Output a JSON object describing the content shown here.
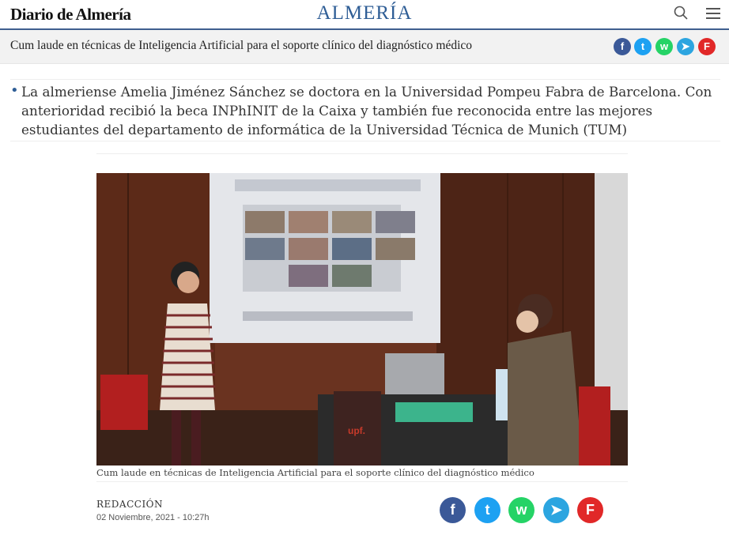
{
  "header": {
    "logo": "Diario de Almería",
    "section": "ALMERÍA",
    "search_icon": "search-icon",
    "menu_icon": "hamburger-menu-icon"
  },
  "title_bar": {
    "title": "Cum laude en técnicas de Inteligencia Artificial para el soporte clínico del diagnóstico médico",
    "share": [
      {
        "name": "facebook-icon",
        "glyph": "f",
        "color": "#3b5998"
      },
      {
        "name": "twitter-icon",
        "glyph": "t",
        "color": "#1da1f2"
      },
      {
        "name": "whatsapp-icon",
        "glyph": "w",
        "color": "#25d366"
      },
      {
        "name": "telegram-icon",
        "glyph": "➤",
        "color": "#2ca5e0"
      },
      {
        "name": "flipboard-icon",
        "glyph": "F",
        "color": "#e12828"
      }
    ]
  },
  "lead": "La almeriense Amelia Jiménez Sánchez se doctora en la Universidad Pompeu Fabra de Barcelona. Con anterioridad recibió la beca INPhINIT de la Caixa y también fue reconocida entre las mejores estudiantes del departamento de informática de la Universidad Técnica de Munich (TUM)",
  "photo": {
    "caption": "Cum laude en técnicas de Inteligencia Artificial para el soporte clínico del diagnóstico médico",
    "podium_logo": "upf."
  },
  "byline": {
    "author": "REDACCIÓN",
    "date": "02 Noviembre, 2021 - 10:27h"
  },
  "share_bottom": [
    {
      "name": "facebook-share-button",
      "glyph": "f",
      "color": "#3b5998"
    },
    {
      "name": "twitter-share-button",
      "glyph": "t",
      "color": "#1da1f2"
    },
    {
      "name": "whatsapp-share-button",
      "glyph": "w",
      "color": "#25d366"
    },
    {
      "name": "telegram-share-button",
      "glyph": "➤",
      "color": "#2ca5e0"
    },
    {
      "name": "flipboard-share-button",
      "glyph": "F",
      "color": "#e12828"
    }
  ]
}
